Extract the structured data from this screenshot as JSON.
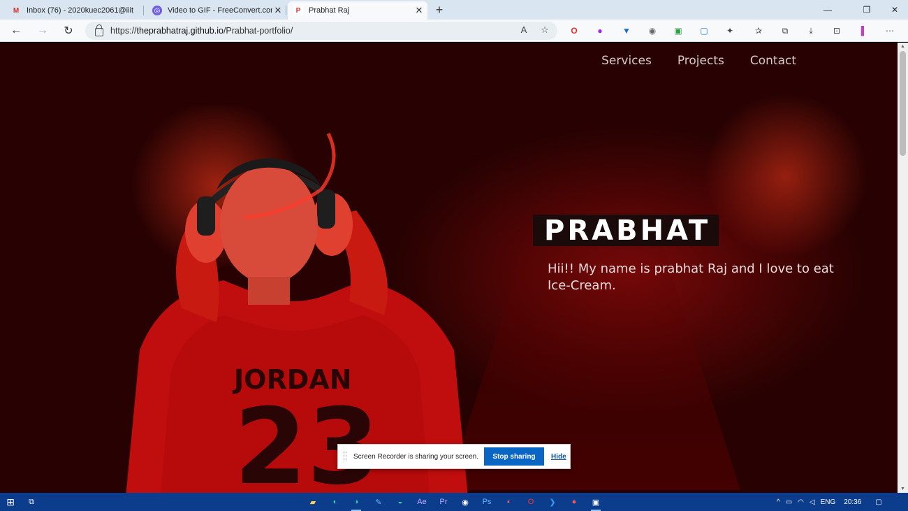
{
  "browser": {
    "tabs": [
      {
        "title": "Inbox (76) - 2020kuec2061@iiit",
        "favicon_color": "#d93025",
        "active": false
      },
      {
        "title": "Video to GIF - FreeConvert.com",
        "favicon_color": "#6c5ce7",
        "active": false
      },
      {
        "title": "Prabhat Raj",
        "favicon_color": "#e03131",
        "active": true
      }
    ],
    "new_tab": "+",
    "url_prefix": "https://",
    "url_host": "theprabhatraj.github.io",
    "url_path": "/Prabhat-portfolio/"
  },
  "page": {
    "nav": [
      "Services",
      "Projects",
      "Contact"
    ],
    "heading": "PRABHAT",
    "intro": "Hii!! My name is prabhat Raj and I love to eat Ice-Cream.",
    "shirt_text": "JORDAN",
    "shirt_number": "23"
  },
  "share_banner": {
    "message": "Screen Recorder is sharing your screen.",
    "stop_label": "Stop sharing",
    "hide_label": "Hide"
  },
  "taskbar": {
    "language": "ENG",
    "time": "20:36"
  }
}
